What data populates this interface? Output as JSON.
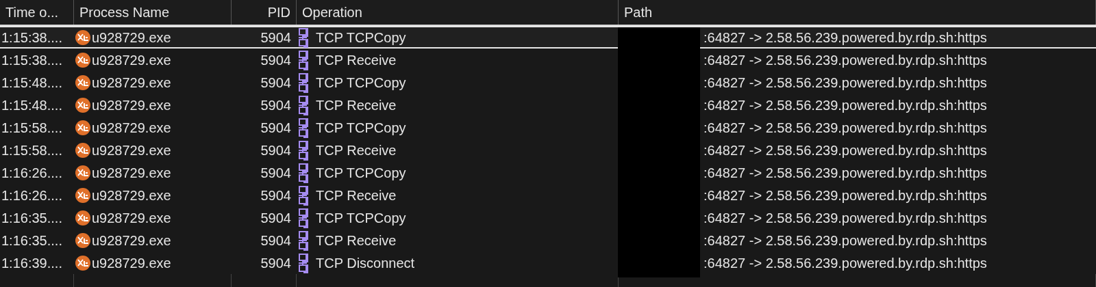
{
  "table": {
    "columns": [
      "Time o...",
      "Process Name",
      "PID",
      "Operation",
      "Path"
    ],
    "rows": [
      {
        "time": "1:15:38....",
        "process": "u928729.exe",
        "pid": "5904",
        "operation": "TCP TCPCopy",
        "path": ":64827 -> 2.58.56.239.powered.by.rdp.sh:https",
        "selected": true
      },
      {
        "time": "1:15:38....",
        "process": "u928729.exe",
        "pid": "5904",
        "operation": "TCP Receive",
        "path": ":64827 -> 2.58.56.239.powered.by.rdp.sh:https",
        "selected": false
      },
      {
        "time": "1:15:48....",
        "process": "u928729.exe",
        "pid": "5904",
        "operation": "TCP TCPCopy",
        "path": ":64827 -> 2.58.56.239.powered.by.rdp.sh:https",
        "selected": false
      },
      {
        "time": "1:15:48....",
        "process": "u928729.exe",
        "pid": "5904",
        "operation": "TCP Receive",
        "path": ":64827 -> 2.58.56.239.powered.by.rdp.sh:https",
        "selected": false
      },
      {
        "time": "1:15:58....",
        "process": "u928729.exe",
        "pid": "5904",
        "operation": "TCP TCPCopy",
        "path": ":64827 -> 2.58.56.239.powered.by.rdp.sh:https",
        "selected": false
      },
      {
        "time": "1:15:58....",
        "process": "u928729.exe",
        "pid": "5904",
        "operation": "TCP Receive",
        "path": ":64827 -> 2.58.56.239.powered.by.rdp.sh:https",
        "selected": false
      },
      {
        "time": "1:16:26....",
        "process": "u928729.exe",
        "pid": "5904",
        "operation": "TCP TCPCopy",
        "path": ":64827 -> 2.58.56.239.powered.by.rdp.sh:https",
        "selected": false
      },
      {
        "time": "1:16:26....",
        "process": "u928729.exe",
        "pid": "5904",
        "operation": "TCP Receive",
        "path": ":64827 -> 2.58.56.239.powered.by.rdp.sh:https",
        "selected": false
      },
      {
        "time": "1:16:35....",
        "process": "u928729.exe",
        "pid": "5904",
        "operation": "TCP TCPCopy",
        "path": ":64827 -> 2.58.56.239.powered.by.rdp.sh:https",
        "selected": false
      },
      {
        "time": "1:16:35....",
        "process": "u928729.exe",
        "pid": "5904",
        "operation": "TCP Receive",
        "path": ":64827 -> 2.58.56.239.powered.by.rdp.sh:https",
        "selected": false
      },
      {
        "time": "1:16:39....",
        "process": "u928729.exe",
        "pid": "5904",
        "operation": "TCP Disconnect",
        "path": ":64827 -> 2.58.56.239.powered.by.rdp.sh:https",
        "selected": false
      }
    ]
  }
}
